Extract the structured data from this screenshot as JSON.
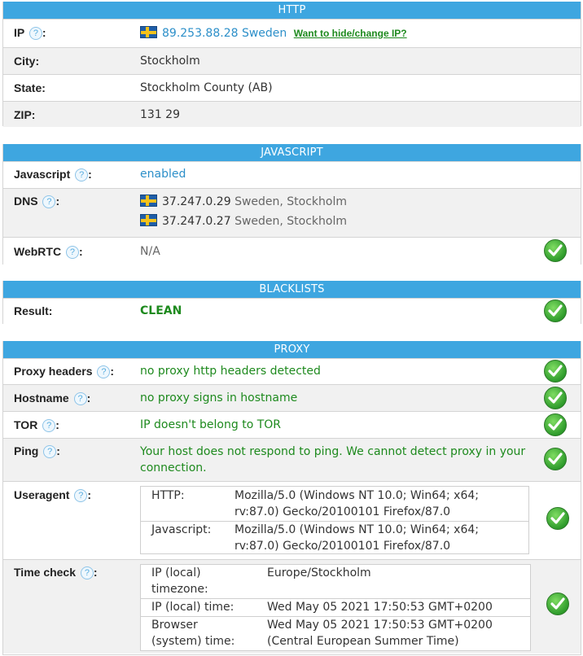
{
  "http": {
    "header": "HTTP",
    "ip_label": "IP",
    "ip_value": "89.253.88.28 Sweden",
    "hide_link": "Want to hide/change IP?",
    "city_label": "City:",
    "city_value": "Stockholm",
    "state_label": "State:",
    "state_value": "Stockholm County (AB)",
    "zip_label": "ZIP:",
    "zip_value": "131 29"
  },
  "javascript": {
    "header": "JAVASCRIPT",
    "js_label": "Javascript",
    "js_value": "enabled",
    "dns_label": "DNS",
    "dns": [
      {
        "ip": "37.247.0.29",
        "loc": "Sweden, Stockholm"
      },
      {
        "ip": "37.247.0.27",
        "loc": "Sweden, Stockholm"
      }
    ],
    "webrtc_label": "WebRTC",
    "webrtc_value": "N/A"
  },
  "blacklists": {
    "header": "BLACKLISTS",
    "result_label": "Result:",
    "result_value": "CLEAN"
  },
  "proxy": {
    "header": "PROXY",
    "headers_label": "Proxy headers",
    "headers_value": "no proxy http headers detected",
    "hostname_label": "Hostname",
    "hostname_value": "no proxy signs in hostname",
    "tor_label": "TOR",
    "tor_value": "IP doesn't belong to TOR",
    "ping_label": "Ping",
    "ping_value_1": "Your host does not respond to ping. We cannot detect proxy in your",
    "ping_value_2": "connection.",
    "ua_label": "Useragent",
    "ua_http_key": "HTTP:",
    "ua_http_1": "Mozilla/5.0 (Windows NT 10.0; Win64; x64;",
    "ua_http_2": "rv:87.0) Gecko/20100101 Firefox/87.0",
    "ua_js_key": "Javascript:",
    "ua_js_1": "Mozilla/5.0 (Windows NT 10.0; Win64; x64;",
    "ua_js_2": "rv:87.0) Gecko/20100101 Firefox/87.0",
    "time_label": "Time check",
    "tz_key_1": "IP (local)",
    "tz_key_2": "timezone:",
    "tz_value": "Europe/Stockholm",
    "iptime_key": "IP (local) time:",
    "iptime_value": "Wed May 05 2021 17:50:53 GMT+0200",
    "btime_key_1": "Browser",
    "btime_key_2": "(system) time:",
    "btime_value_1": "Wed May 05 2021 17:50:53 GMT+0200",
    "btime_value_2": "(Central European Summer Time)"
  },
  "help_glyph": "?",
  "colon": ":"
}
